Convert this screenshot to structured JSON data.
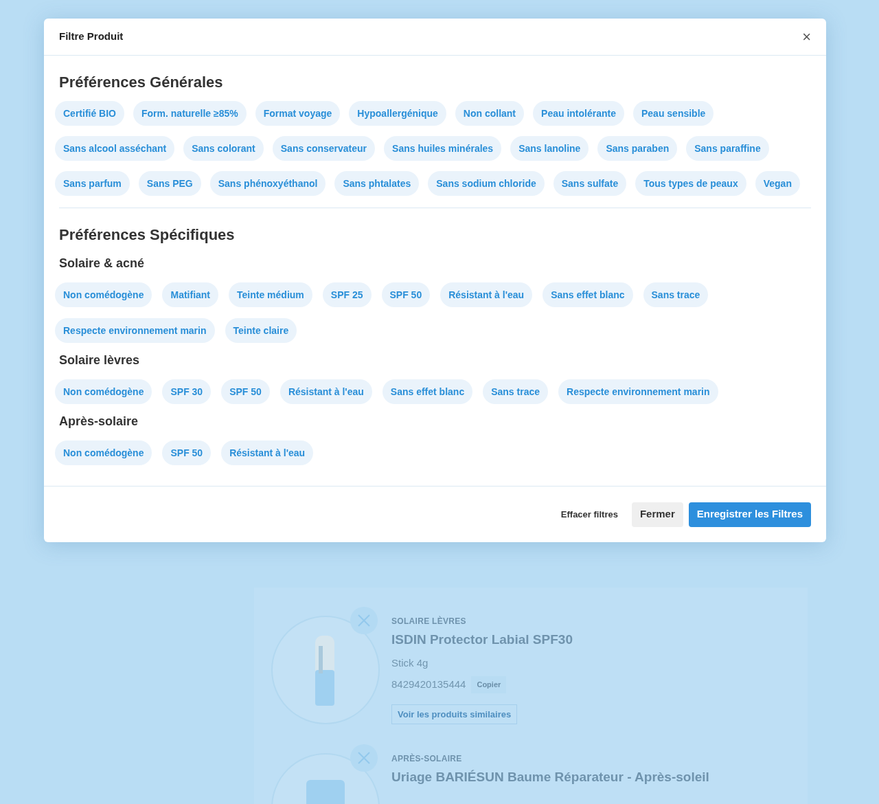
{
  "dialog": {
    "title": "Filtre Produit",
    "close": "×"
  },
  "general": {
    "heading": "Préférences Générales",
    "chips": [
      "Certifié BIO",
      "Form. naturelle ≥85%",
      "Format voyage",
      "Hypoallergénique",
      "Non collant",
      "Peau intolérante",
      "Peau sensible",
      "Sans alcool asséchant",
      "Sans colorant",
      "Sans conservateur",
      "Sans huiles minérales",
      "Sans lanoline",
      "Sans paraben",
      "Sans paraffine",
      "Sans parfum",
      "Sans PEG",
      "Sans phénoxyéthanol",
      "Sans phtalates",
      "Sans sodium chloride",
      "Sans sulfate",
      "Tous types de peaux",
      "Vegan"
    ]
  },
  "specific": {
    "heading": "Préférences Spécifiques",
    "groups": [
      {
        "title": "Solaire & acné",
        "chips": [
          "Non comédogène",
          "Matifiant",
          "Teinte médium",
          "SPF 25",
          "SPF 50",
          "Résistant à l'eau",
          "Sans effet blanc",
          "Sans trace",
          "Respecte environnement marin",
          "Teinte claire"
        ]
      },
      {
        "title": "Solaire lèvres",
        "chips": [
          "Non comédogène",
          "SPF 30",
          "SPF 50",
          "Résistant à l'eau",
          "Sans effet blanc",
          "Sans trace",
          "Respecte environnement marin"
        ]
      },
      {
        "title": "Après-solaire",
        "chips": [
          "Non comédogène",
          "SPF 50",
          "Résistant à l'eau"
        ]
      }
    ]
  },
  "footer": {
    "clear": "Effacer filtres",
    "close": "Fermer",
    "save": "Enregistrer les Filtres"
  },
  "background_products": [
    {
      "category": "SOLAIRE LÈVRES",
      "name": "ISDIN Protector Labial SPF30",
      "size": "Stick 4g",
      "ean": "8429420135444",
      "copy": "Copier",
      "similar": "Voir les produits similaires"
    },
    {
      "category": "APRÈS-SOLAIRE",
      "name": "Uriage BARIÉSUN Baume Réparateur - Après-soleil"
    }
  ]
}
